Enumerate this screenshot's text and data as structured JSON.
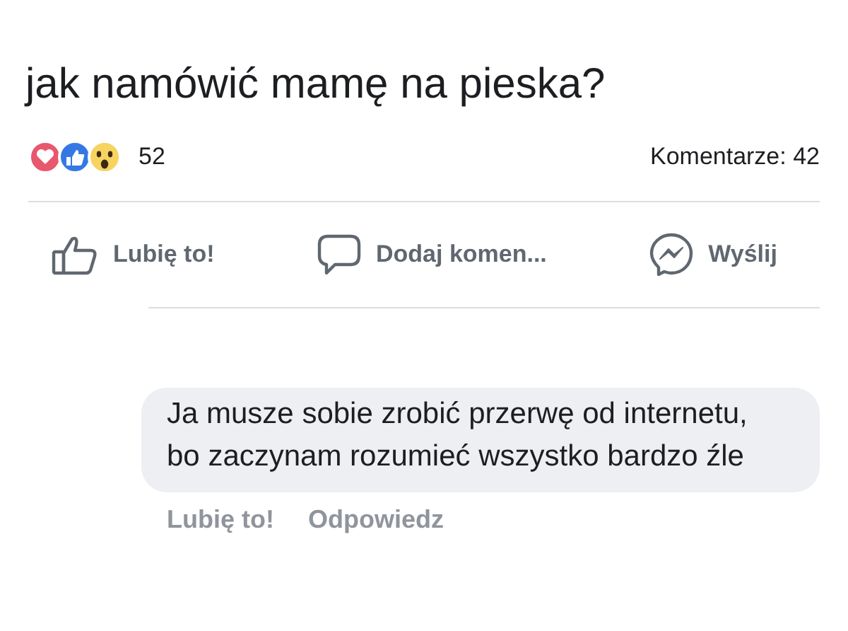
{
  "post": {
    "text": "jak namówić mamę na pieska?"
  },
  "reactions": {
    "count": "52",
    "comments": "Komentarze: 42"
  },
  "actions": [
    {
      "kind": "like",
      "label": "Lubię to!"
    },
    {
      "kind": "comment",
      "label": "Dodaj komen..."
    },
    {
      "kind": "send",
      "label": "Wyślij"
    }
  ],
  "comment": {
    "text": "Ja musze sobie zrobić przerwę od internetu, bo zaczynam rozumieć wszystko bardzo źle",
    "links": [
      "Lubię to!",
      "Odpowiedz"
    ]
  }
}
